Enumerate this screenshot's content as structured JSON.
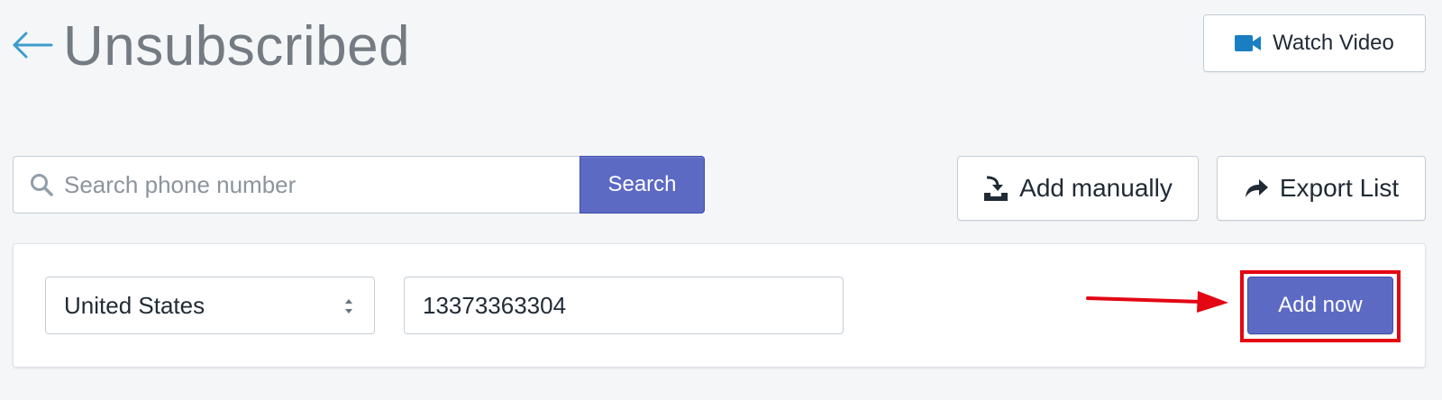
{
  "header": {
    "title": "Unsubscribed",
    "back_icon": "arrow-left-icon",
    "watch_video_label": "Watch Video",
    "watch_video_icon": "video-camera-icon"
  },
  "toolbar": {
    "search_placeholder": "Search phone number",
    "search_value": "",
    "search_button_label": "Search",
    "add_manually_label": "Add manually",
    "add_manually_icon": "import-tray-icon",
    "export_label": "Export List",
    "export_icon": "share-arrow-icon"
  },
  "add_form": {
    "country_selected": "United States",
    "phone_value": "13373363304",
    "add_now_label": "Add now"
  },
  "colors": {
    "accent": "#5c6ac4",
    "back_arrow": "#3d9ccb",
    "video_icon": "#1a7ec2",
    "annotation": "#e30613"
  }
}
